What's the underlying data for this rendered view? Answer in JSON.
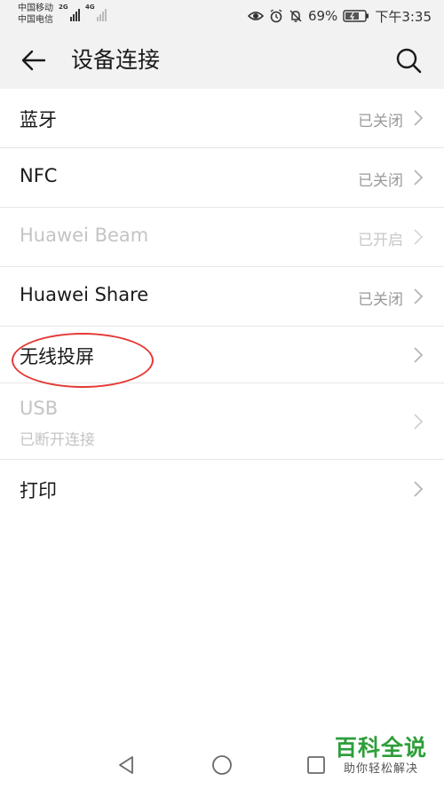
{
  "status_bar": {
    "carrier_1": "中国移动",
    "carrier_2": "中国电信",
    "net_1": "2G",
    "net_2": "4G",
    "battery": "69%",
    "time": "下午3:35"
  },
  "app_bar": {
    "title": "设备连接"
  },
  "items": [
    {
      "title": "蓝牙",
      "value": "已关闭",
      "enabled": true
    },
    {
      "title": "NFC",
      "value": "已关闭",
      "enabled": true
    },
    {
      "title": "Huawei Beam",
      "value": "已开启",
      "enabled": false
    },
    {
      "title": "Huawei Share",
      "value": "已关闭",
      "enabled": true
    },
    {
      "title": "无线投屏",
      "value": "",
      "enabled": true
    },
    {
      "title": "USB",
      "subtitle": "已断开连接",
      "value": "",
      "enabled": false
    },
    {
      "title": "打印",
      "value": "",
      "enabled": true
    }
  ],
  "watermark": {
    "main": "百科全说",
    "sub": "助你轻松解决"
  },
  "colors": {
    "appbar_bg": "#f2f2f2",
    "highlight_ring": "#e53935",
    "watermark_green": "#2e9e3a"
  }
}
